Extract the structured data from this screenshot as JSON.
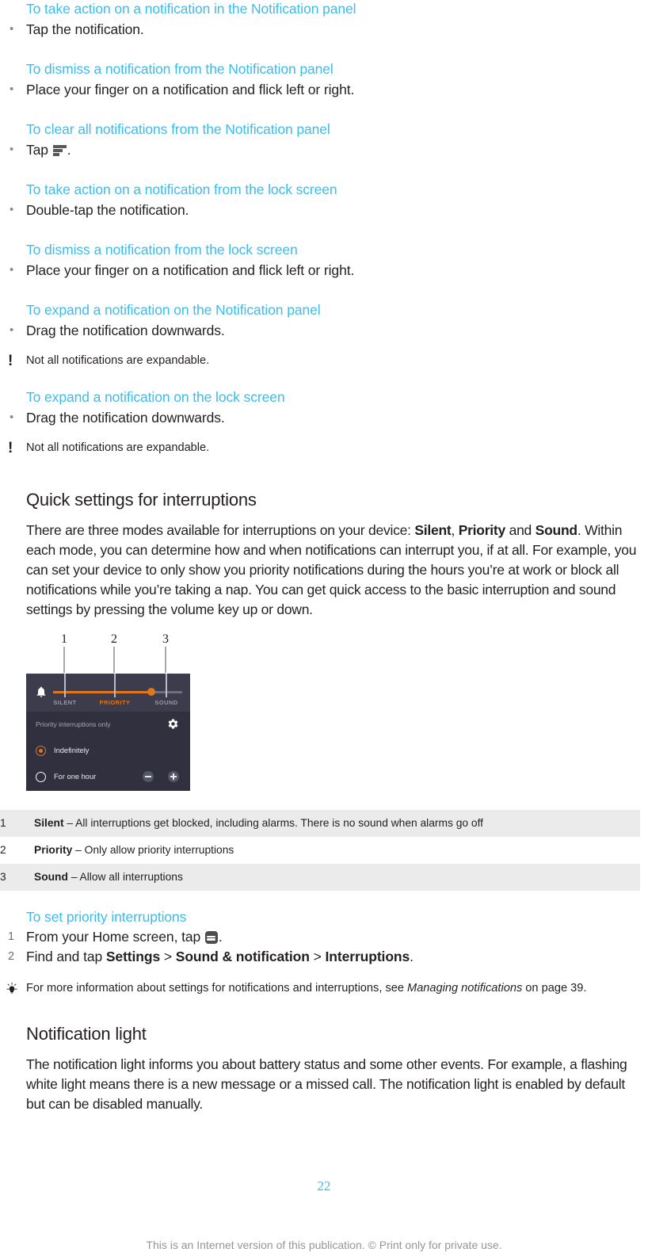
{
  "procedures": [
    {
      "title": "To take action on a notification in the Notification panel",
      "bullet": "Tap the notification."
    },
    {
      "title": "To dismiss a notification from the Notification panel",
      "bullet": "Place your finger on a notification and flick left or right."
    },
    {
      "title": "To clear all notifications from the Notification panel",
      "bullet_prefix": "Tap",
      "bullet_suffix": ".",
      "icon": "clear-all-icon"
    },
    {
      "title": "To take action on a notification from the lock screen",
      "bullet": "Double-tap the notification."
    },
    {
      "title": "To dismiss a notification from the lock screen",
      "bullet": "Place your finger on a notification and flick left or right."
    },
    {
      "title": "To expand a notification on the Notification panel",
      "bullet": "Drag the notification downwards.",
      "note": "Not all notifications are expandable."
    },
    {
      "title": "To expand a notification on the lock screen",
      "bullet": "Drag the notification downwards.",
      "note": "Not all notifications are expandable."
    }
  ],
  "quick_settings": {
    "heading": "Quick settings for interruptions",
    "body_part1": "There are three modes available for interruptions on your device: ",
    "mode1": "Silent",
    "body_part2": ", ",
    "mode2": "Priority",
    "body_part3": " and ",
    "mode3": "Sound",
    "body_part4": ". Within each mode, you can determine how and when notifications can interrupt you, if at all. For example, you can set your device to only show you priority notifications during the hours you’re at work or block all notifications while you’re taking a nap. You can get quick access to the basic interruption and sound settings by pressing the volume key up or down."
  },
  "figure": {
    "callouts": [
      "1",
      "2",
      "3"
    ],
    "bell_icon": "bell-icon",
    "gear_icon": "gear-icon",
    "modes": [
      "SILENT",
      "PRIORITY",
      "SOUND"
    ],
    "active_mode": "PRIORITY",
    "priority_row_label": "Priority interruptions only",
    "options": [
      {
        "label": "Indefinitely",
        "selected": true
      },
      {
        "label": "For one hour",
        "selected": false
      }
    ],
    "minus_icon": "minus-circle-icon",
    "plus_icon": "plus-circle-icon",
    "accent_color": "#e2761b"
  },
  "legend_table": {
    "rows": [
      {
        "num": "1",
        "term": "Silent",
        "desc": " – All interruptions get blocked, including alarms. There is no sound when alarms go off"
      },
      {
        "num": "2",
        "term": "Priority",
        "desc": " – Only allow priority interruptions"
      },
      {
        "num": "3",
        "term": "Sound",
        "desc": " – Allow all interruptions"
      }
    ]
  },
  "priority_procedure": {
    "title": "To set priority interruptions",
    "step1_num": "1",
    "step1_prefix": "From your Home screen, tap",
    "step1_suffix": ".",
    "step1_icon": "app-drawer-icon",
    "step2_num": "2",
    "step2_prefix": "Find and tap ",
    "step2_settings": "Settings",
    "step2_sep1": " > ",
    "step2_sound": "Sound & notification",
    "step2_sep2": " > ",
    "step2_interruptions": "Interruptions",
    "step2_end": ".",
    "tip_icon": "lightbulb-icon",
    "tip_prefix": "For more information about settings for notifications and interruptions, see ",
    "tip_italic": "Managing notifications",
    "tip_suffix": " on page 39."
  },
  "notification_light": {
    "heading": "Notification light",
    "body": "The notification light informs you about battery status and some other events. For example, a flashing white light means there is a new message or a missed call. The notification light is enabled by default but can be disabled manually."
  },
  "footer": {
    "page_number": "22",
    "note": "This is an Internet version of this publication. © Print only for private use."
  }
}
